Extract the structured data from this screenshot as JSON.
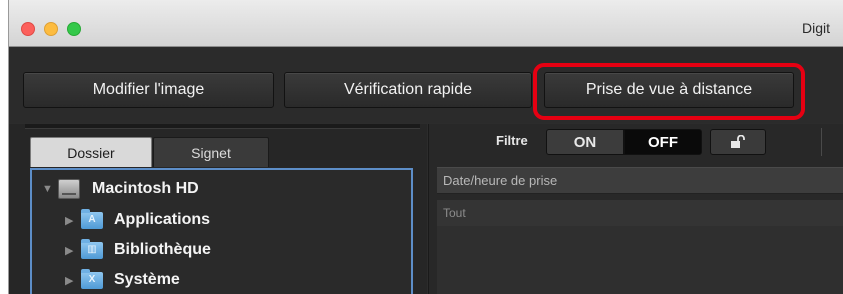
{
  "window": {
    "title": "Digit"
  },
  "toolbar": {
    "buttons": [
      {
        "label": "Modifier l'image"
      },
      {
        "label": "Vérification rapide"
      },
      {
        "label": "Prise de vue à distance"
      }
    ],
    "highlight_color": "#e60012"
  },
  "left_panel": {
    "tabs": [
      {
        "label": "Dossier",
        "active": true
      },
      {
        "label": "Signet",
        "active": false
      }
    ],
    "tree": [
      {
        "label": "Macintosh HD",
        "icon": "hard-drive-icon",
        "expanded": true
      },
      {
        "label": "Applications",
        "icon": "folder-icon",
        "expanded": false
      },
      {
        "label": "Bibliothèque",
        "icon": "folder-icon",
        "expanded": false
      },
      {
        "label": "Système",
        "icon": "folder-icon",
        "expanded": false
      }
    ],
    "selection_border_color": "#5d8ec8"
  },
  "right_panel": {
    "filter": {
      "label": "Filtre",
      "on_label": "ON",
      "off_label": "OFF",
      "selected": "OFF"
    },
    "filter_header": "Date/heure de prise",
    "filter_value": "Tout"
  }
}
